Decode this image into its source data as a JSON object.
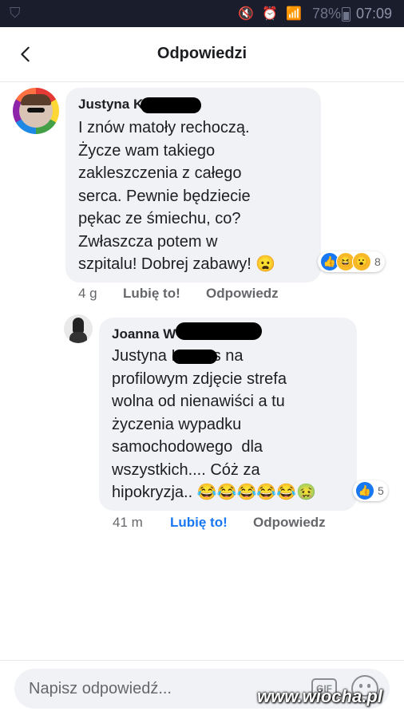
{
  "status_bar": {
    "battery": "78%",
    "time": "07:09"
  },
  "header": {
    "title": "Odpowiedzi"
  },
  "comments": [
    {
      "author": "Justyna K",
      "lines": [
        "I znów matoły rechoczą.",
        "Życze wam takiego",
        "zakleszczenia z całego",
        "serca. Pewnie będziecie",
        "pękac ze śmiechu, co?",
        "Zwłaszcza potem w",
        "szpitalu! Dobrej zabawy! 😦"
      ],
      "reaction_count": "8",
      "time": "4 g",
      "like_label": "Lubię to!",
      "reply_label": "Odpowiedz"
    },
    {
      "author": "Joanna W",
      "lines": [
        "Justyna K       s na",
        "profilowym zdjęcie strefa",
        "wolna od nienawiści a tu",
        "życzenia wypadku",
        "samochodowego  dla",
        "wszystkich.... Cóż za",
        "hipokryzja.. 😂😂😂😂😂🤢"
      ],
      "reaction_count": "5",
      "time": "41 m",
      "like_label": "Lubię to!",
      "reply_label": "Odpowiedz"
    }
  ],
  "composer": {
    "placeholder": "Napisz odpowiedź...",
    "gif_label": "GIF"
  },
  "watermark": "www.wiocha.pl",
  "colors": {
    "accent": "#1877f2",
    "bubble": "#f0f2f5",
    "status_bar": "#1a1d2b"
  }
}
